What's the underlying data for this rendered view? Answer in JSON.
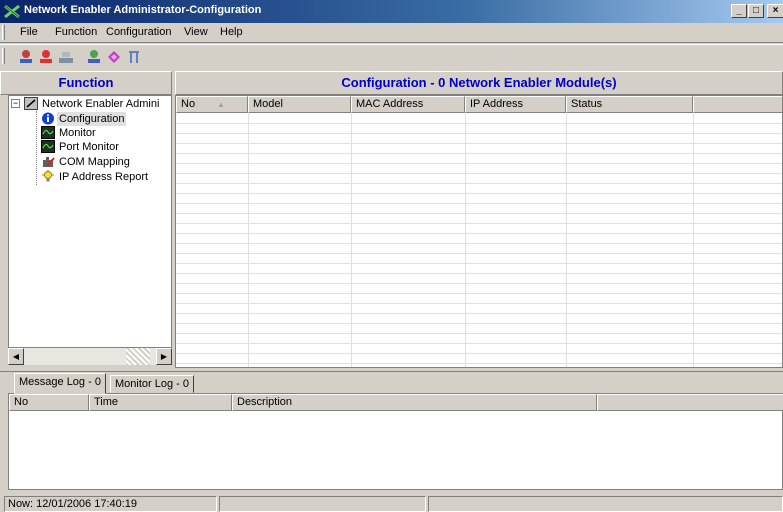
{
  "window": {
    "title": "Network Enabler Administrator-Configuration",
    "icon": "network-enabler-app-icon",
    "controls": {
      "minimize": "_",
      "maximize": "□",
      "close": "×"
    }
  },
  "menu": {
    "items": [
      {
        "label": "File"
      },
      {
        "label": "Function"
      },
      {
        "label": "Configuration"
      },
      {
        "label": "View"
      },
      {
        "label": "Help"
      }
    ]
  },
  "toolbar": {
    "buttons": [
      {
        "icon": "search-device-icon"
      },
      {
        "icon": "search-ip-icon"
      },
      {
        "icon": "configure-icon"
      },
      {
        "icon": "upgrade-firmware-icon"
      },
      {
        "icon": "export-icon"
      },
      {
        "icon": "exit-icon"
      }
    ]
  },
  "function_panel": {
    "header": "Function",
    "tree": {
      "root": "Network Enabler Admini",
      "expand_glyph": "−",
      "children": [
        {
          "label": "Configuration",
          "icon": "info-icon",
          "selected": true
        },
        {
          "label": "Monitor",
          "icon": "monitor-icon"
        },
        {
          "label": "Port Monitor",
          "icon": "port-monitor-icon"
        },
        {
          "label": "COM Mapping",
          "icon": "com-mapping-icon"
        },
        {
          "label": "IP Address Report",
          "icon": "ip-report-icon"
        }
      ]
    },
    "scroll": {
      "left": "◀",
      "right": "▶"
    }
  },
  "config_panel": {
    "header": "Configuration - 0 Network Enabler Module(s)",
    "columns": [
      {
        "label": "No",
        "sort": "▲"
      },
      {
        "label": "Model"
      },
      {
        "label": "MAC Address"
      },
      {
        "label": "IP Address"
      },
      {
        "label": "Status"
      },
      {
        "label": ""
      }
    ]
  },
  "tabs": [
    {
      "label": "Message Log - 0",
      "active": true
    },
    {
      "label": "Monitor Log - 0",
      "active": false
    }
  ],
  "log_panel": {
    "columns": [
      {
        "label": "No"
      },
      {
        "label": "Time"
      },
      {
        "label": "Description"
      },
      {
        "label": ""
      }
    ]
  },
  "statusbar": {
    "now": "Now: 12/01/2006 17:40:19"
  },
  "colors": {
    "header_text": "#0000c0",
    "title_bar_start": "#0a246a",
    "title_bar_end": "#a6caf0"
  }
}
